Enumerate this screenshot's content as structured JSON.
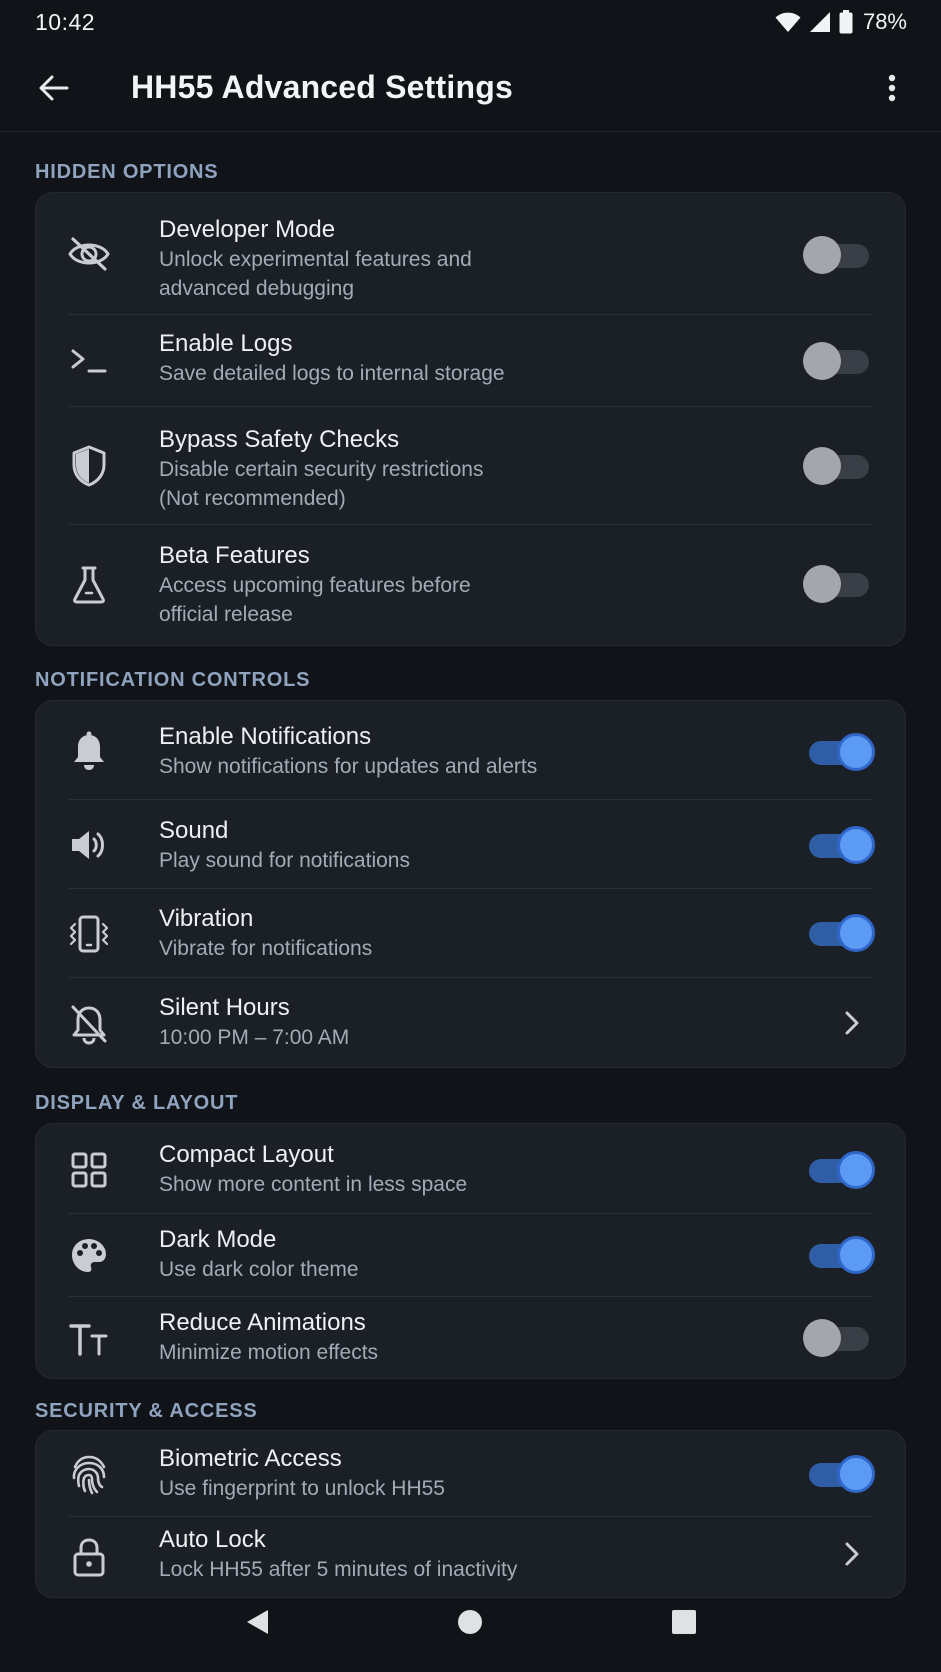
{
  "status": {
    "time": "10:42",
    "battery": "78%"
  },
  "appbar": {
    "title": "HH55 Advanced Settings"
  },
  "sections": {
    "hidden": {
      "label": "HIDDEN OPTIONS",
      "items": [
        {
          "title": "Developer Mode",
          "sub1": "Unlock experimental features and",
          "sub2": "advanced debugging",
          "icon": "eye-off-icon",
          "state": "off"
        },
        {
          "title": "Enable Logs",
          "sub1": "Save detailed logs to internal storage",
          "icon": "terminal-icon",
          "state": "off"
        },
        {
          "title": "Bypass Safety Checks",
          "sub1": "Disable certain security restrictions",
          "sub2": "(Not recommended)",
          "icon": "shield-icon",
          "state": "off"
        },
        {
          "title": "Beta Features",
          "sub1": "Access upcoming features before",
          "sub2": "official release",
          "icon": "flask-icon",
          "state": "off"
        }
      ]
    },
    "notifications": {
      "label": "NOTIFICATION CONTROLS",
      "items": [
        {
          "title": "Enable Notifications",
          "sub1": "Show notifications for updates and alerts",
          "icon": "bell-icon",
          "state": "on"
        },
        {
          "title": "Sound",
          "sub1": "Play sound for notifications",
          "icon": "speaker-icon",
          "state": "on"
        },
        {
          "title": "Vibration",
          "sub1": "Vibrate for notifications",
          "icon": "vibration-icon",
          "state": "on"
        },
        {
          "title": "Silent Hours",
          "sub1": "10:00 PM – 7:00 AM",
          "icon": "bell-off-icon",
          "state": "nav"
        }
      ]
    },
    "display": {
      "label": "DISPLAY & LAYOUT",
      "items": [
        {
          "title": "Compact Layout",
          "sub1": "Show more content in less space",
          "icon": "grid-icon",
          "state": "on"
        },
        {
          "title": "Dark Mode",
          "sub1": "Use dark color theme",
          "icon": "palette-icon",
          "state": "on"
        },
        {
          "title": "Reduce Animations",
          "sub1": "Minimize motion effects",
          "icon": "text-size-icon",
          "state": "off"
        }
      ]
    },
    "security": {
      "label": "SECURITY & ACCESS",
      "items": [
        {
          "title": "Biometric Access",
          "sub1": "Use fingerprint to unlock HH55",
          "icon": "fingerprint-icon",
          "state": "on"
        },
        {
          "title": "Auto Lock",
          "sub1": "Lock HH55 after 5 minutes of inactivity",
          "icon": "lock-icon",
          "state": "nav"
        }
      ]
    }
  },
  "colors": {
    "background": "#101318",
    "card": "#1b1f26",
    "accent": "#5b9bf5",
    "section_label": "#8fa3bf"
  }
}
